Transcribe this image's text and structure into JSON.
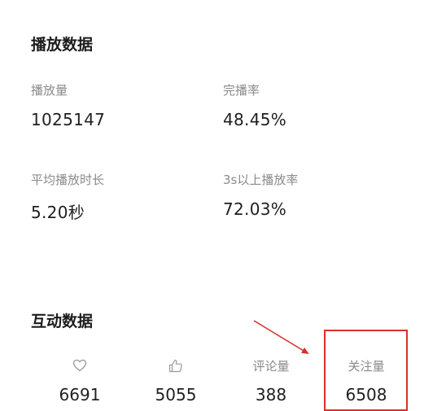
{
  "playback": {
    "title": "播放数据",
    "metrics": [
      {
        "label": "播放量",
        "value": "1025147"
      },
      {
        "label": "完播率",
        "value": "48.45%"
      },
      {
        "label": "平均播放时长",
        "value": "5.20秒"
      },
      {
        "label": "3s以上播放率",
        "value": "72.03%"
      }
    ]
  },
  "interaction": {
    "title": "互动数据",
    "items": [
      {
        "icon": "heart-icon",
        "value": "6691"
      },
      {
        "icon": "thumbs-up-icon",
        "value": "5055"
      },
      {
        "label": "评论量",
        "value": "388"
      },
      {
        "label": "关注量",
        "value": "6508"
      }
    ]
  },
  "colors": {
    "annotation_red": "#d9302c",
    "label_gray": "#8a8a8a",
    "value_dark": "#1f1f1f"
  }
}
